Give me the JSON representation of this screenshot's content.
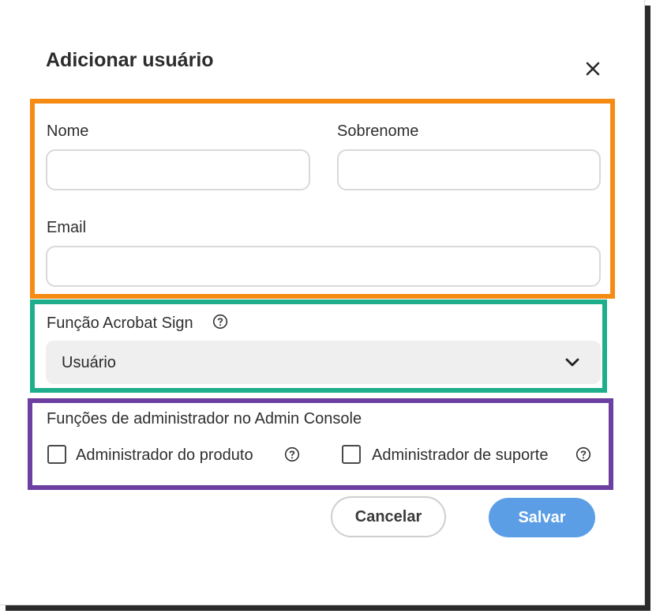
{
  "dialog": {
    "title": "Adicionar usuário",
    "close_icon": "close-icon"
  },
  "name_section": {
    "first_name_label": "Nome",
    "first_name_value": "",
    "last_name_label": "Sobrenome",
    "last_name_value": "",
    "email_label": "Email",
    "email_value": ""
  },
  "role_section": {
    "label": "Função Acrobat Sign",
    "help_icon": "help-circle-icon",
    "selected_value": "Usuário",
    "dropdown_icon": "chevron-down-icon"
  },
  "admin_section": {
    "heading": "Funções de administrador no Admin Console",
    "options": [
      {
        "label": "Administrador do produto",
        "checked": false,
        "help_icon": "help-circle-icon"
      },
      {
        "label": "Administrador de suporte",
        "checked": false,
        "help_icon": "help-circle-icon"
      }
    ]
  },
  "footer": {
    "cancel_label": "Cancelar",
    "save_label": "Salvar"
  },
  "annotation_colors": {
    "orange": "#f58b12",
    "green": "#1fae8c",
    "purple": "#6d3fa0"
  },
  "colors": {
    "primary_button": "#5b9ee6",
    "select_background": "#efefef"
  }
}
